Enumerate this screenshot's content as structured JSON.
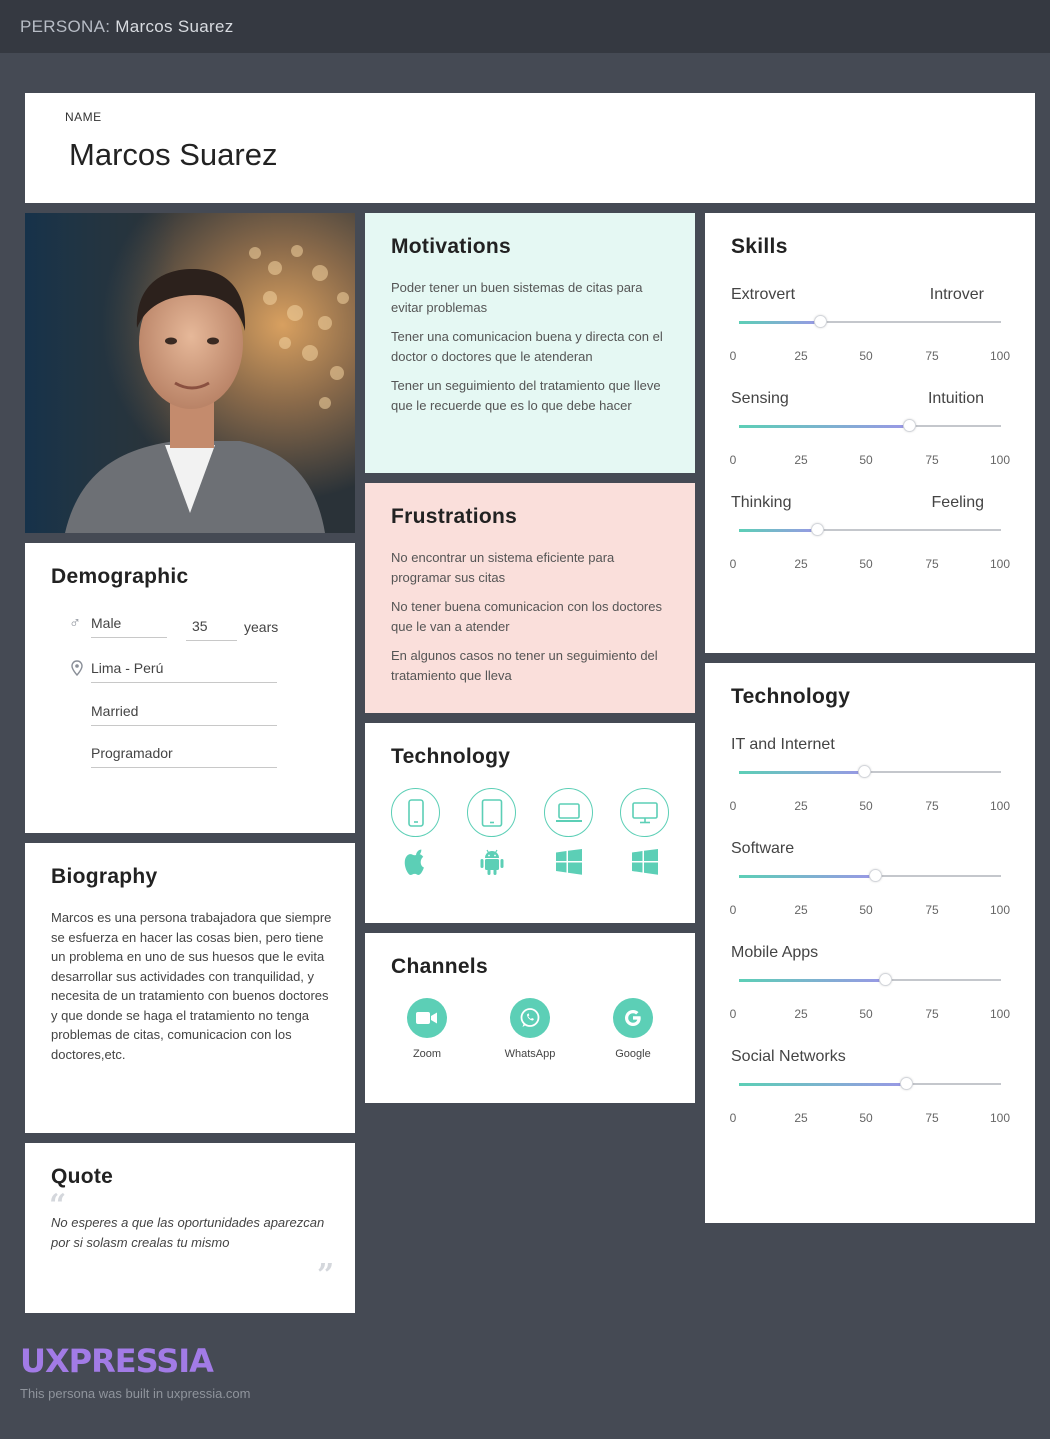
{
  "topbar": {
    "prefix": "PERSONA:",
    "name": "Marcos Suarez"
  },
  "name_card": {
    "label": "NAME",
    "value": "Marcos Suarez"
  },
  "demographic": {
    "title": "Demographic",
    "gender": "Male",
    "age": "35",
    "age_unit": "years",
    "location": "Lima - Perú",
    "status": "Married",
    "occupation": "Programador",
    "icons": {
      "gender": "male-icon",
      "location": "pin-icon"
    }
  },
  "biography": {
    "title": "Biography",
    "text": "Marcos es una persona trabajadora que siempre se esfuerza en hacer las cosas bien, pero tiene un problema en uno de sus huesos que le evita desarrollar sus actividades con tranquilidad, y necesita de un tratamiento con buenos doctores y que donde se haga el tratamiento no tenga problemas de citas, comunicacion con los doctores,etc."
  },
  "quote": {
    "title": "Quote",
    "text": "No esperes a que las oportunidades aparezcan por si solasm crealas tu mismo"
  },
  "motivations": {
    "title": "Motivations",
    "items": [
      "Poder tener un buen sistemas de citas para evitar problemas",
      "Tener una comunicacion buena y directa con el doctor o doctores que le atenderan",
      "Tener un seguimiento del tratamiento que lleve que le recuerde que es lo que debe hacer"
    ]
  },
  "frustrations": {
    "title": "Frustrations",
    "items": [
      "No encontrar un sistema eficiente para programar sus citas",
      "No tener buena comunicacion con los doctores que le van a atender",
      "En algunos casos no tener un seguimiento del tratamiento que lleva"
    ]
  },
  "technology_devices": {
    "title": "Technology",
    "devices": [
      "phone-icon",
      "tablet-icon",
      "laptop-icon",
      "desktop-icon"
    ],
    "os": [
      "apple-icon",
      "android-icon",
      "windows-icon",
      "windows-icon"
    ]
  },
  "channels": {
    "title": "Channels",
    "items": [
      {
        "label": "Zoom",
        "icon": "video-camera-icon"
      },
      {
        "label": "WhatsApp",
        "icon": "whatsapp-icon"
      },
      {
        "label": "Google",
        "icon": "google-icon"
      }
    ]
  },
  "skills": {
    "title": "Skills",
    "ticks": [
      "0",
      "25",
      "50",
      "75",
      "100"
    ],
    "sliders": [
      {
        "left": "Extrovert",
        "right": "Introver",
        "value": 31
      },
      {
        "left": "Sensing",
        "right": "Intuition",
        "value": 65
      },
      {
        "left": "Thinking",
        "right": "Feeling",
        "value": 30
      }
    ]
  },
  "technology_levels": {
    "title": "Technology",
    "ticks": [
      "0",
      "25",
      "50",
      "75",
      "100"
    ],
    "sliders": [
      {
        "left": "IT and Internet",
        "value": 48
      },
      {
        "left": "Software",
        "value": 52
      },
      {
        "left": "Mobile Apps",
        "value": 56
      },
      {
        "left": "Social Networks",
        "value": 64
      }
    ]
  },
  "footer": {
    "brand": "UXPRESSIA",
    "note": "This persona was built in uxpressia.com",
    "brand_color": "#a27be6"
  },
  "colors": {
    "accent": "#5ccfb6",
    "accent2": "#9a97e6",
    "motivation_bg": "#e5f8f3",
    "frustration_bg": "#fadfdb"
  }
}
